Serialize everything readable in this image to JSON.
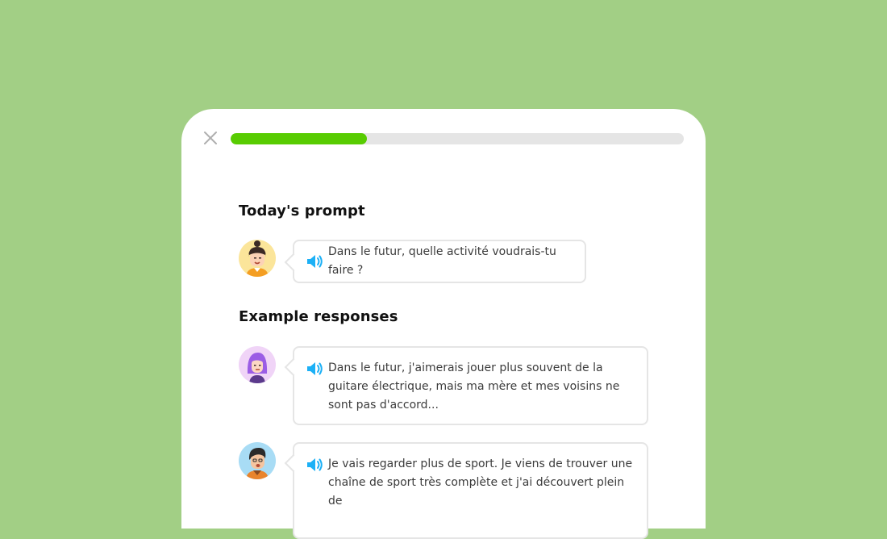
{
  "progress": {
    "value": 0.3
  },
  "colors": {
    "background": "#a2cf85",
    "progress_fill": "#58cc02",
    "speaker": "#1cb0f6"
  },
  "icons": {
    "close": "close-icon",
    "speaker": "speaker-icon"
  },
  "prompt_section": {
    "title": "Today's prompt",
    "message": "Dans le futur, quelle activité voudrais-tu faire ?"
  },
  "examples_section": {
    "title": "Example responses",
    "responses": [
      {
        "text": "Dans le futur, j'aimerais jouer plus souvent de la guitare électrique, mais ma mère et mes voisins ne sont pas d'accord..."
      },
      {
        "text": "Je vais regarder plus de sport. Je viens de trouver une chaîne de sport très complète et j'ai découvert plein de"
      }
    ]
  }
}
